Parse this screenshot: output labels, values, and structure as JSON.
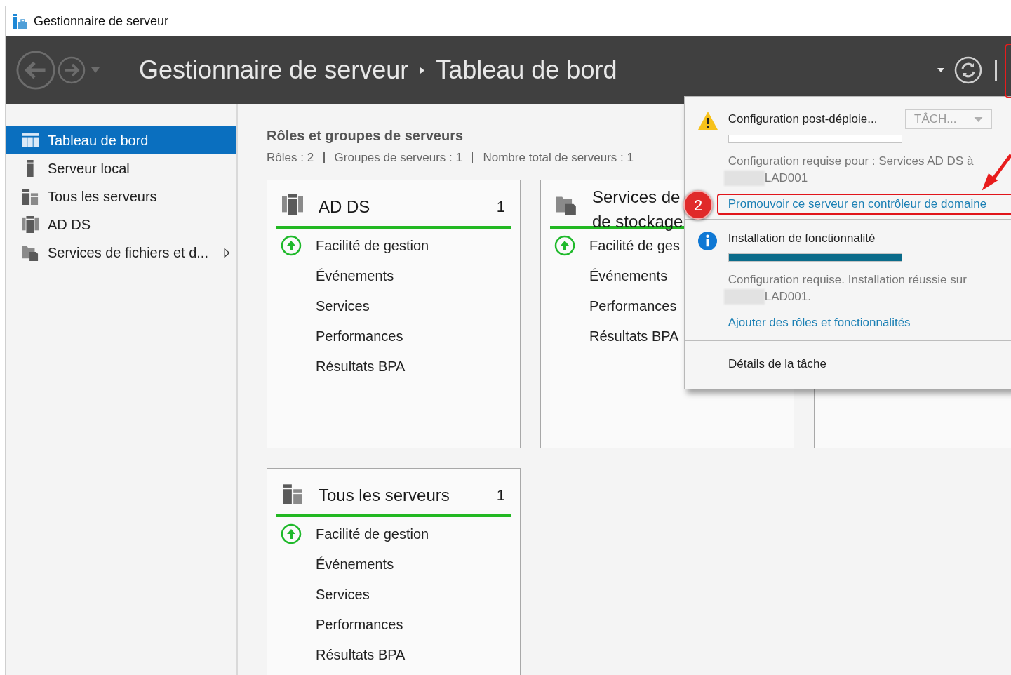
{
  "window": {
    "title": "Gestionnaire de serveur"
  },
  "header": {
    "breadcrumb": [
      "Gestionnaire de serveur",
      "Tableau de bord"
    ]
  },
  "sidebar": {
    "items": [
      {
        "label": "Tableau de bord",
        "kind": "dashboard",
        "selected": true,
        "expandable": false
      },
      {
        "label": "Serveur local",
        "kind": "server",
        "selected": false,
        "expandable": false
      },
      {
        "label": "Tous les serveurs",
        "kind": "servers",
        "selected": false,
        "expandable": false
      },
      {
        "label": "AD DS",
        "kind": "adds",
        "selected": false,
        "expandable": false
      },
      {
        "label": "Services de fichiers et d...",
        "kind": "files",
        "selected": false,
        "expandable": true
      }
    ]
  },
  "roles": {
    "title": "Rôles et groupes de serveurs",
    "summary": [
      "Rôles : 2",
      "Groupes de serveurs : 1",
      "Nombre total de serveurs : 1"
    ],
    "cards": [
      {
        "kind": "adds",
        "title_lines": [
          "AD DS"
        ],
        "count": "1",
        "rows": [
          {
            "label": "Facilité de gestion",
            "ok": true
          },
          {
            "label": "Événements",
            "ok": false
          },
          {
            "label": "Services",
            "ok": false
          },
          {
            "label": "Performances",
            "ok": false
          },
          {
            "label": "Résultats BPA",
            "ok": false
          }
        ]
      },
      {
        "kind": "files",
        "title_lines": [
          "Services de",
          "de stockage"
        ],
        "rows": [
          {
            "label": "Facilité de ges",
            "ok": true
          },
          {
            "label": "Événements",
            "ok": false
          },
          {
            "label": "Performances",
            "ok": false
          },
          {
            "label": "Résultats BPA",
            "ok": false
          }
        ]
      },
      {
        "kind": "blank"
      },
      {
        "kind": "servers",
        "title_lines": [
          "Tous les serveurs"
        ],
        "count": "1",
        "rows": [
          {
            "label": "Facilité de gestion",
            "ok": true
          },
          {
            "label": "Événements",
            "ok": false
          },
          {
            "label": "Services",
            "ok": false
          },
          {
            "label": "Performances",
            "ok": false
          },
          {
            "label": "Résultats BPA",
            "ok": false
          }
        ]
      }
    ]
  },
  "notifications": {
    "tasks": [
      {
        "kind": "warning",
        "title": "Configuration post-déploie...",
        "button": "TÂCH...",
        "level": 0,
        "message": "Configuration requise pour : Services AD DS à",
        "host": "LAD001",
        "link": "Promouvoir ce serveur en contrôleur de domaine",
        "highlighted": true
      },
      {
        "kind": "info",
        "title": "Installation de fonctionnalité",
        "level": 1,
        "message": "Configuration requise. Installation réussie sur",
        "host": "LAD001.",
        "link": "Ajouter des rôles et fonctionnalités",
        "highlighted": false
      }
    ],
    "footer": "Détails de la tâche"
  },
  "annotation": {
    "badge": "2"
  }
}
